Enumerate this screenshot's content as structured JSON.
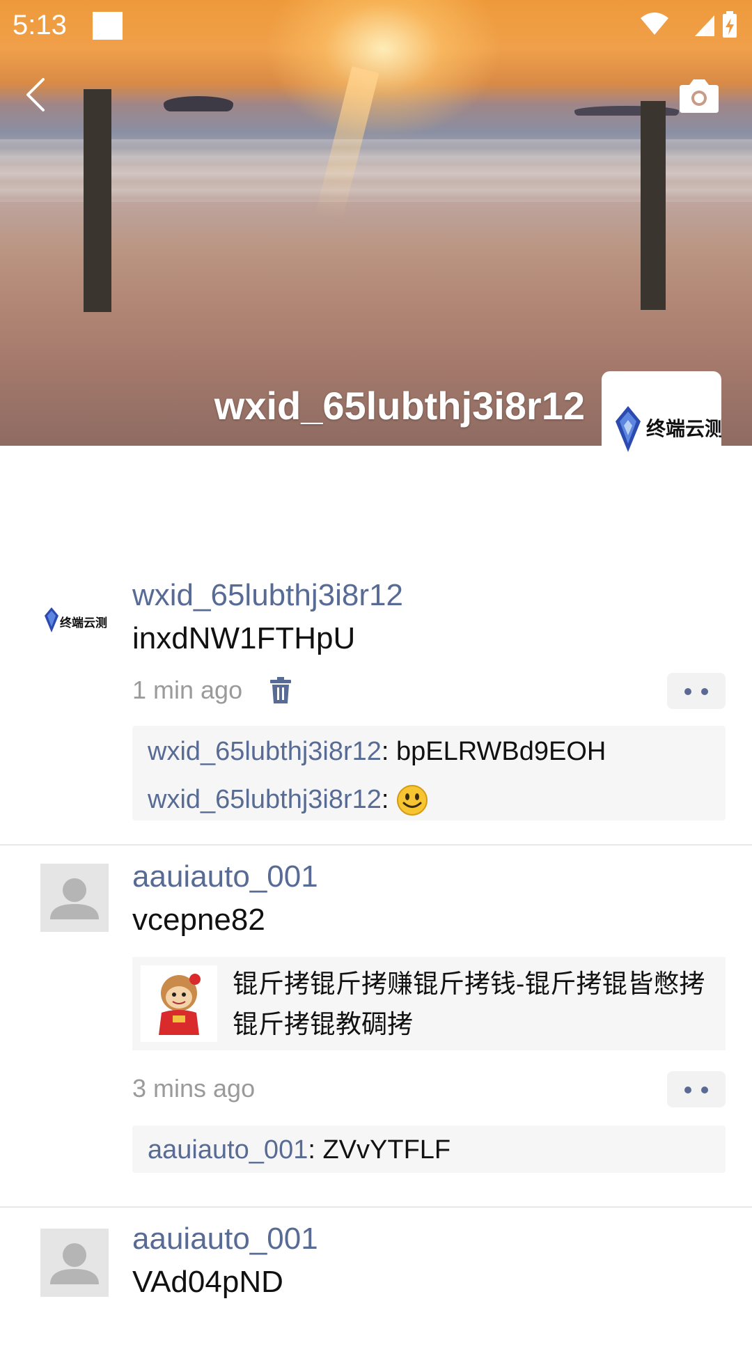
{
  "status_bar": {
    "time": "5:13"
  },
  "cover": {
    "username": "wxid_65lubthj3i8r12",
    "avatar_logo_text": "终端云测"
  },
  "posts": [
    {
      "author": "wxid_65lubthj3i8r12",
      "avatar_logo_text": "终端云测",
      "text": "inxdNW1FTHpU",
      "time": "1 min ago",
      "comments": [
        {
          "name": "wxid_65lubthj3i8r12",
          "sep": ": ",
          "text": "bpELRWBd9EOH"
        },
        {
          "name": "wxid_65lubthj3i8r12",
          "sep": ": ",
          "text": ""
        }
      ]
    },
    {
      "author": "aauiauto_001",
      "text": "vcepne82",
      "share_text": "锟斤拷锟斤拷赚锟斤拷钱-锟斤拷锟皆憋拷锟斤拷锟教碉拷",
      "time": "3 mins ago",
      "comments": [
        {
          "name": "aauiauto_001",
          "sep": ": ",
          "text": "ZVvYTFLF"
        }
      ]
    },
    {
      "author": "aauiauto_001",
      "text": "VAd04pND"
    }
  ],
  "colors": {
    "name_link": "#586b95",
    "time_grey": "#9a9a9a",
    "comment_bg": "#f6f6f6"
  },
  "icons": [
    "back-arrow-icon",
    "camera-icon",
    "wifi-icon",
    "signal-icon",
    "battery-charging-icon",
    "trash-icon",
    "more-dots-icon",
    "smile-emoji-icon",
    "default-avatar-icon"
  ]
}
